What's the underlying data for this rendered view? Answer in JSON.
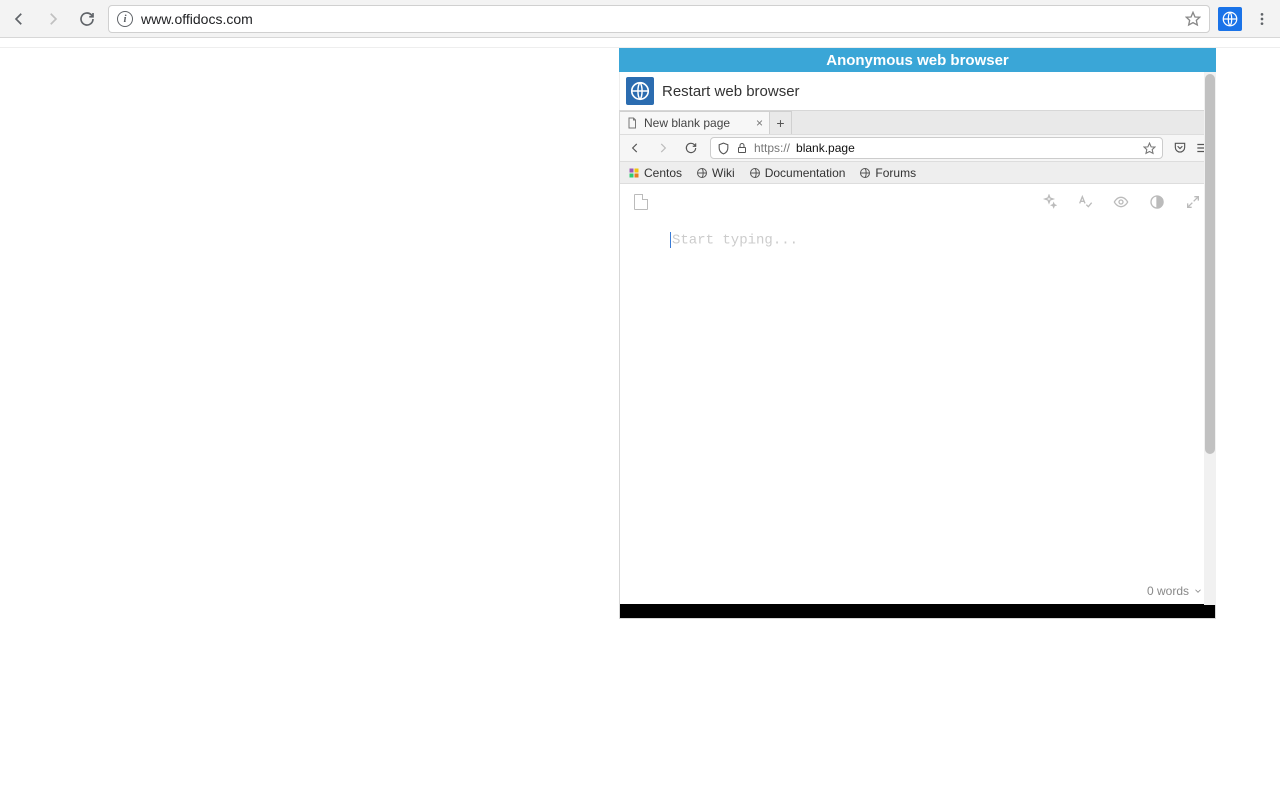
{
  "chrome": {
    "url": "www.offidocs.com"
  },
  "anon": {
    "title": "Anonymous web browser",
    "restart": "Restart web browser"
  },
  "ff": {
    "tab": "New blank page",
    "url_proto": "https://",
    "url_host": "blank.page",
    "bookmarks": [
      "Centos",
      "Wiki",
      "Documentation",
      "Forums"
    ],
    "placeholder": "Start typing...",
    "wordcount": "0 words"
  }
}
